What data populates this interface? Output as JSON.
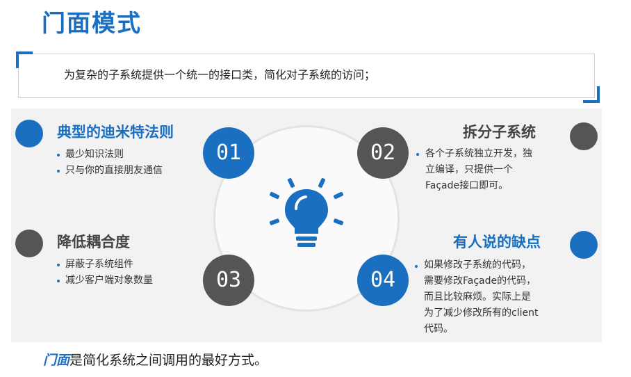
{
  "title": "门面模式",
  "definition": "为复杂的子系统提供一个统一的接口类，简化对子系统的访问；",
  "points": {
    "p1": {
      "number": "01",
      "heading": "典型的迪米特法则",
      "items": [
        "最少知识法则",
        "只与你的直接朋友通信"
      ]
    },
    "p2": {
      "number": "02",
      "heading": "拆分子系统",
      "lines": [
        "各个子系统独立开发，独",
        "立编译，只提供一个",
        "Façade接口即可。"
      ]
    },
    "p3": {
      "number": "03",
      "heading": "降低耦合度",
      "items": [
        "屏蔽子系统组件",
        "减少客户端对象数量"
      ]
    },
    "p4": {
      "number": "04",
      "heading": "有人说的缺点",
      "lines": [
        "如果修改子系统的代码，",
        "需要修改Façade的代码，",
        "而且比较麻烦。实际上是",
        "为了减少修改所有的client",
        "代码。"
      ]
    }
  },
  "footer": {
    "emphasis": "门面",
    "rest": "是简化系统之间调用的最好方式。"
  },
  "colors": {
    "blue": "#1a6fc0",
    "grey": "#555557",
    "text": "#333333"
  },
  "icons": {
    "center": "lightbulb-icon"
  }
}
